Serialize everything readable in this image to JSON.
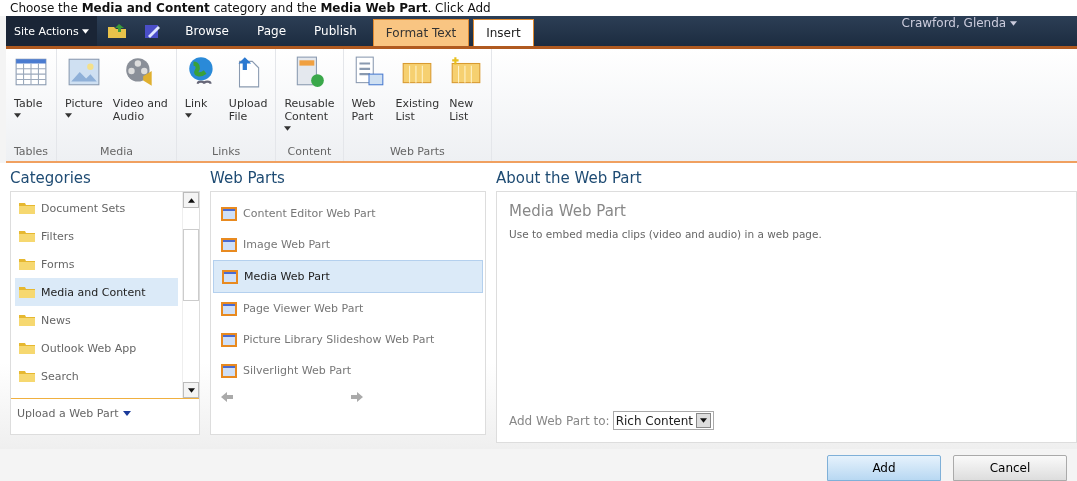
{
  "caption": "Choose the **Media and Content** category and the **Media Web Part**. Click Add",
  "top_bar": {
    "site_actions": "Site Actions",
    "tabs": [
      {
        "label": "Browse",
        "contextual": false,
        "selected": false
      },
      {
        "label": "Page",
        "contextual": false,
        "selected": false
      },
      {
        "label": "Publish",
        "contextual": false,
        "selected": false
      },
      {
        "label": "Format Text",
        "contextual": true,
        "selected": false
      },
      {
        "label": "Insert",
        "contextual": true,
        "selected": true
      }
    ],
    "user": "Crawford, Glenda"
  },
  "ribbon": [
    {
      "label": "Tables",
      "buttons": [
        {
          "kind": "table",
          "lines": [
            "Table"
          ],
          "dropdown": true
        }
      ]
    },
    {
      "label": "Media",
      "buttons": [
        {
          "kind": "picture",
          "lines": [
            "Picture"
          ],
          "dropdown": true
        },
        {
          "kind": "video",
          "lines": [
            "Video and",
            "Audio"
          ],
          "dropdown": false
        }
      ]
    },
    {
      "label": "Links",
      "buttons": [
        {
          "kind": "link",
          "lines": [
            "Link"
          ],
          "dropdown": true
        },
        {
          "kind": "upload",
          "lines": [
            "Upload",
            "File"
          ],
          "dropdown": false
        }
      ]
    },
    {
      "label": "Content",
      "buttons": [
        {
          "kind": "reusable",
          "lines": [
            "Reusable",
            "Content"
          ],
          "dropdown": true
        }
      ]
    },
    {
      "label": "Web Parts",
      "buttons": [
        {
          "kind": "webpart",
          "lines": [
            "Web",
            "Part"
          ],
          "dropdown": false
        },
        {
          "kind": "list",
          "lines": [
            "Existing",
            "List"
          ],
          "dropdown": false
        },
        {
          "kind": "newlist",
          "lines": [
            "New",
            "List"
          ],
          "dropdown": false
        }
      ]
    }
  ],
  "categories": {
    "heading": "Categories",
    "items": [
      {
        "label": "Document Sets",
        "selected": false
      },
      {
        "label": "Filters",
        "selected": false
      },
      {
        "label": "Forms",
        "selected": false
      },
      {
        "label": "Media and Content",
        "selected": true
      },
      {
        "label": "News",
        "selected": false
      },
      {
        "label": "Outlook Web App",
        "selected": false
      },
      {
        "label": "Search",
        "selected": false
      }
    ],
    "upload_link": "Upload a Web Part"
  },
  "web_parts": {
    "heading": "Web Parts",
    "items": [
      {
        "label": "Content Editor Web Part",
        "selected": false
      },
      {
        "label": "Image Web Part",
        "selected": false
      },
      {
        "label": "Media Web Part",
        "selected": true
      },
      {
        "label": "Page Viewer Web Part",
        "selected": false
      },
      {
        "label": "Picture Library Slideshow Web Part",
        "selected": false
      },
      {
        "label": "Silverlight Web Part",
        "selected": false
      }
    ]
  },
  "about": {
    "heading": "About the Web Part",
    "title": "Media Web Part",
    "description": "Use to embed media clips (video and audio) in a web page.",
    "add_to_label": "Add Web Part to:",
    "add_to_value": "Rich Content"
  },
  "buttons": [
    {
      "label": "Add",
      "primary": true
    },
    {
      "label": "Cancel",
      "primary": false
    }
  ]
}
